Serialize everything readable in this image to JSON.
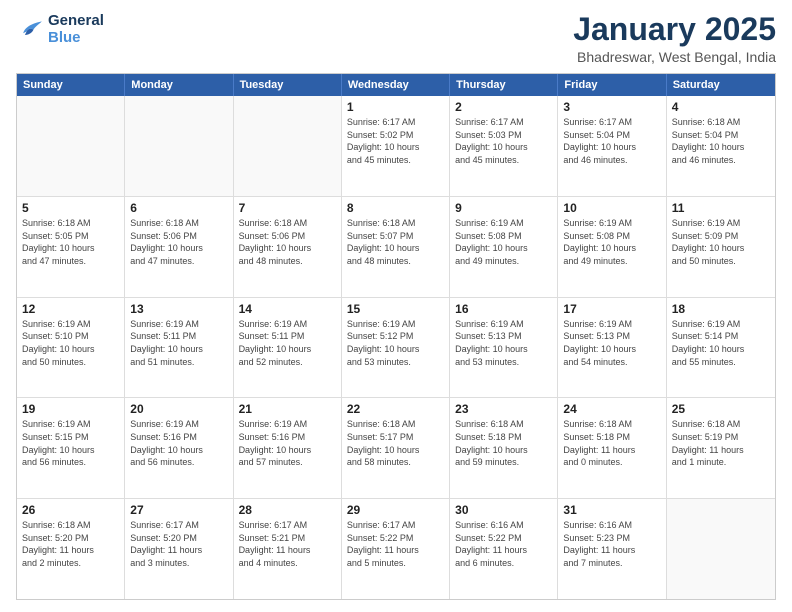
{
  "logo": {
    "line1": "General",
    "line2": "Blue"
  },
  "title": "January 2025",
  "location": "Bhadreswar, West Bengal, India",
  "weekdays": [
    "Sunday",
    "Monday",
    "Tuesday",
    "Wednesday",
    "Thursday",
    "Friday",
    "Saturday"
  ],
  "weeks": [
    [
      {
        "day": "",
        "info": ""
      },
      {
        "day": "",
        "info": ""
      },
      {
        "day": "",
        "info": ""
      },
      {
        "day": "1",
        "info": "Sunrise: 6:17 AM\nSunset: 5:02 PM\nDaylight: 10 hours\nand 45 minutes."
      },
      {
        "day": "2",
        "info": "Sunrise: 6:17 AM\nSunset: 5:03 PM\nDaylight: 10 hours\nand 45 minutes."
      },
      {
        "day": "3",
        "info": "Sunrise: 6:17 AM\nSunset: 5:04 PM\nDaylight: 10 hours\nand 46 minutes."
      },
      {
        "day": "4",
        "info": "Sunrise: 6:18 AM\nSunset: 5:04 PM\nDaylight: 10 hours\nand 46 minutes."
      }
    ],
    [
      {
        "day": "5",
        "info": "Sunrise: 6:18 AM\nSunset: 5:05 PM\nDaylight: 10 hours\nand 47 minutes."
      },
      {
        "day": "6",
        "info": "Sunrise: 6:18 AM\nSunset: 5:06 PM\nDaylight: 10 hours\nand 47 minutes."
      },
      {
        "day": "7",
        "info": "Sunrise: 6:18 AM\nSunset: 5:06 PM\nDaylight: 10 hours\nand 48 minutes."
      },
      {
        "day": "8",
        "info": "Sunrise: 6:18 AM\nSunset: 5:07 PM\nDaylight: 10 hours\nand 48 minutes."
      },
      {
        "day": "9",
        "info": "Sunrise: 6:19 AM\nSunset: 5:08 PM\nDaylight: 10 hours\nand 49 minutes."
      },
      {
        "day": "10",
        "info": "Sunrise: 6:19 AM\nSunset: 5:08 PM\nDaylight: 10 hours\nand 49 minutes."
      },
      {
        "day": "11",
        "info": "Sunrise: 6:19 AM\nSunset: 5:09 PM\nDaylight: 10 hours\nand 50 minutes."
      }
    ],
    [
      {
        "day": "12",
        "info": "Sunrise: 6:19 AM\nSunset: 5:10 PM\nDaylight: 10 hours\nand 50 minutes."
      },
      {
        "day": "13",
        "info": "Sunrise: 6:19 AM\nSunset: 5:11 PM\nDaylight: 10 hours\nand 51 minutes."
      },
      {
        "day": "14",
        "info": "Sunrise: 6:19 AM\nSunset: 5:11 PM\nDaylight: 10 hours\nand 52 minutes."
      },
      {
        "day": "15",
        "info": "Sunrise: 6:19 AM\nSunset: 5:12 PM\nDaylight: 10 hours\nand 53 minutes."
      },
      {
        "day": "16",
        "info": "Sunrise: 6:19 AM\nSunset: 5:13 PM\nDaylight: 10 hours\nand 53 minutes."
      },
      {
        "day": "17",
        "info": "Sunrise: 6:19 AM\nSunset: 5:13 PM\nDaylight: 10 hours\nand 54 minutes."
      },
      {
        "day": "18",
        "info": "Sunrise: 6:19 AM\nSunset: 5:14 PM\nDaylight: 10 hours\nand 55 minutes."
      }
    ],
    [
      {
        "day": "19",
        "info": "Sunrise: 6:19 AM\nSunset: 5:15 PM\nDaylight: 10 hours\nand 56 minutes."
      },
      {
        "day": "20",
        "info": "Sunrise: 6:19 AM\nSunset: 5:16 PM\nDaylight: 10 hours\nand 56 minutes."
      },
      {
        "day": "21",
        "info": "Sunrise: 6:19 AM\nSunset: 5:16 PM\nDaylight: 10 hours\nand 57 minutes."
      },
      {
        "day": "22",
        "info": "Sunrise: 6:18 AM\nSunset: 5:17 PM\nDaylight: 10 hours\nand 58 minutes."
      },
      {
        "day": "23",
        "info": "Sunrise: 6:18 AM\nSunset: 5:18 PM\nDaylight: 10 hours\nand 59 minutes."
      },
      {
        "day": "24",
        "info": "Sunrise: 6:18 AM\nSunset: 5:18 PM\nDaylight: 11 hours\nand 0 minutes."
      },
      {
        "day": "25",
        "info": "Sunrise: 6:18 AM\nSunset: 5:19 PM\nDaylight: 11 hours\nand 1 minute."
      }
    ],
    [
      {
        "day": "26",
        "info": "Sunrise: 6:18 AM\nSunset: 5:20 PM\nDaylight: 11 hours\nand 2 minutes."
      },
      {
        "day": "27",
        "info": "Sunrise: 6:17 AM\nSunset: 5:20 PM\nDaylight: 11 hours\nand 3 minutes."
      },
      {
        "day": "28",
        "info": "Sunrise: 6:17 AM\nSunset: 5:21 PM\nDaylight: 11 hours\nand 4 minutes."
      },
      {
        "day": "29",
        "info": "Sunrise: 6:17 AM\nSunset: 5:22 PM\nDaylight: 11 hours\nand 5 minutes."
      },
      {
        "day": "30",
        "info": "Sunrise: 6:16 AM\nSunset: 5:22 PM\nDaylight: 11 hours\nand 6 minutes."
      },
      {
        "day": "31",
        "info": "Sunrise: 6:16 AM\nSunset: 5:23 PM\nDaylight: 11 hours\nand 7 minutes."
      },
      {
        "day": "",
        "info": ""
      }
    ]
  ]
}
